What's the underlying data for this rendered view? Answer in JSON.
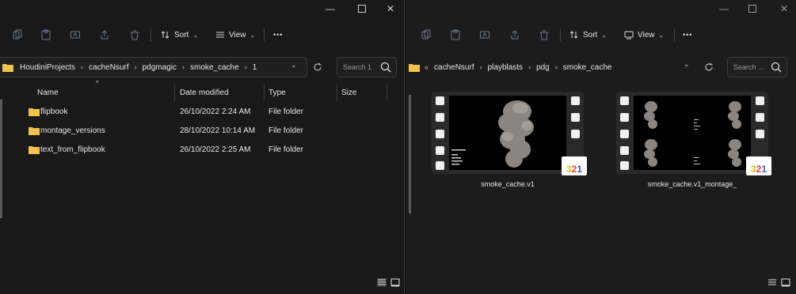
{
  "left_window": {
    "toolbar": {
      "sort_label": "Sort",
      "view_label": "View",
      "more_label": "•••"
    },
    "address": {
      "crumbs": [
        "HoudiniProjects",
        "cacheNsurf",
        "pdgmagic",
        "smoke_cache",
        "1"
      ]
    },
    "search": {
      "placeholder": "Search 1"
    },
    "columns": {
      "name": "Name",
      "date": "Date modified",
      "type": "Type",
      "size": "Size"
    },
    "files": [
      {
        "name": "flipbook",
        "date": "26/10/2022 2:24 AM",
        "type": "File folder"
      },
      {
        "name": "montage_versions",
        "date": "28/10/2022 10:14 AM",
        "type": "File folder"
      },
      {
        "name": "text_from_flipbook",
        "date": "26/10/2022 2:25 AM",
        "type": "File folder"
      }
    ]
  },
  "right_window": {
    "toolbar": {
      "sort_label": "Sort",
      "view_label": "View",
      "more_label": "•••"
    },
    "address": {
      "prefix": "«",
      "crumbs": [
        "cacheNsurf",
        "playblasts",
        "pdg",
        "smoke_cache"
      ]
    },
    "search": {
      "placeholder": "Search ..."
    },
    "items": [
      {
        "label": "smoke_cache.v1"
      },
      {
        "label": "smoke_cache.v1_montage_"
      }
    ],
    "badge": {
      "d1": "3",
      "d2": "2",
      "d3": "1"
    }
  },
  "caption": {
    "minimize": "—",
    "maximize": "☐",
    "close": "✕"
  },
  "colors": {
    "folder": "#f2c14e",
    "accent": "#4a90d9"
  }
}
